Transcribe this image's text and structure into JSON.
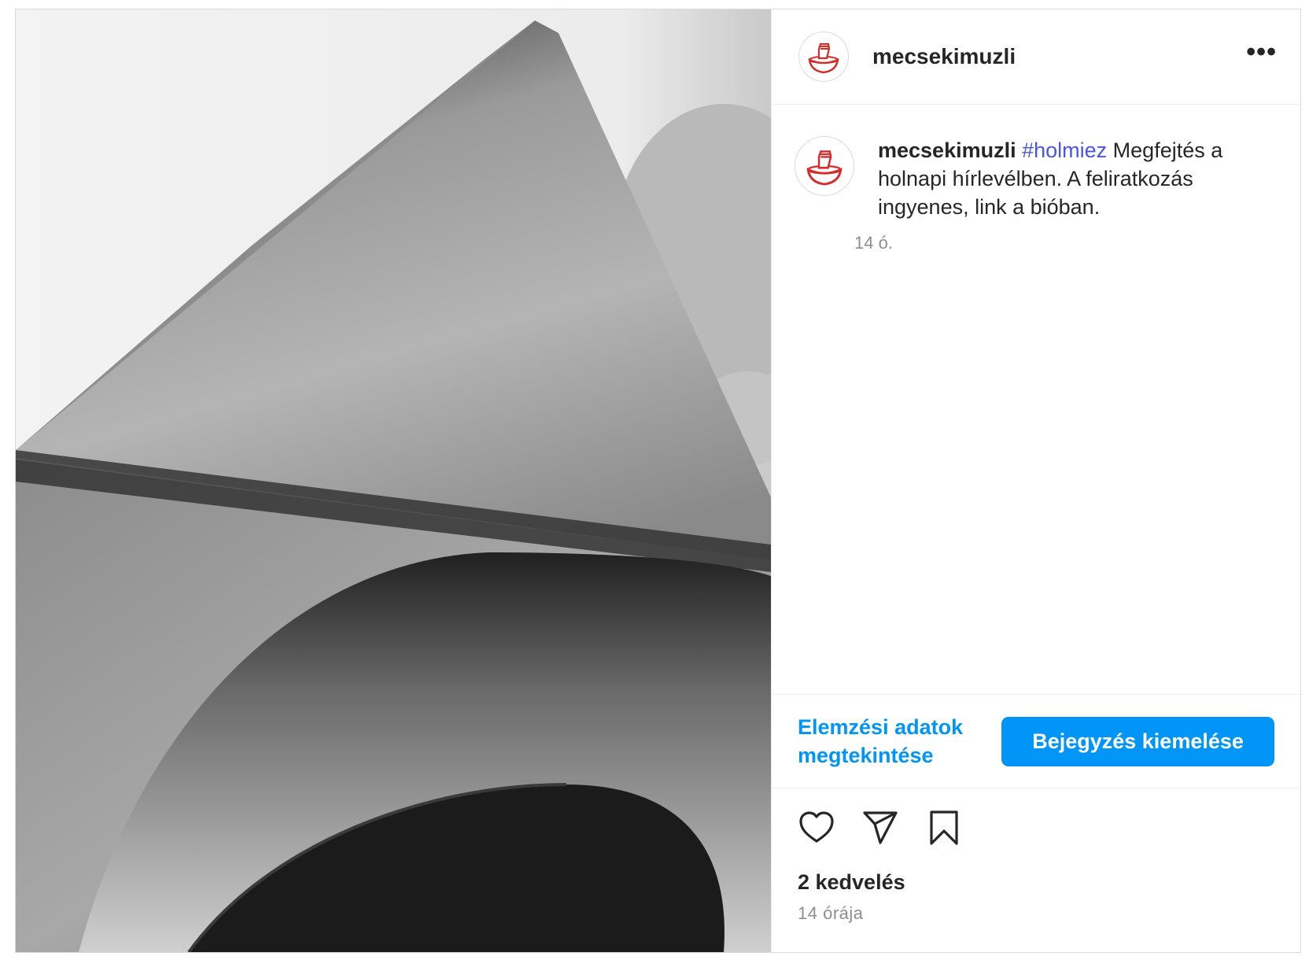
{
  "post": {
    "username": "mecsekimuzli",
    "more_icon": "more-options-icon",
    "avatar_icon": "bowl-fist-logo",
    "caption": {
      "username": "mecsekimuzli",
      "hashtag": "#holmiez",
      "text": " Megfejtés a holnapi hírlevélben. A feliratkozás ingyenes, link a bióban.",
      "time": "14 ó."
    },
    "insights_label": "Elemzési adatok megtekintése",
    "boost_label": "Bejegyzés kiemelése",
    "icons": [
      "heart-icon",
      "share-icon",
      "bookmark-icon"
    ],
    "likes": "2 kedvelés",
    "time": "14 órája"
  },
  "colors": {
    "accent": "#0095f6",
    "hashtag": "#4a55e6",
    "logo_red": "#d62b2b",
    "muted": "#8e8e8e"
  }
}
